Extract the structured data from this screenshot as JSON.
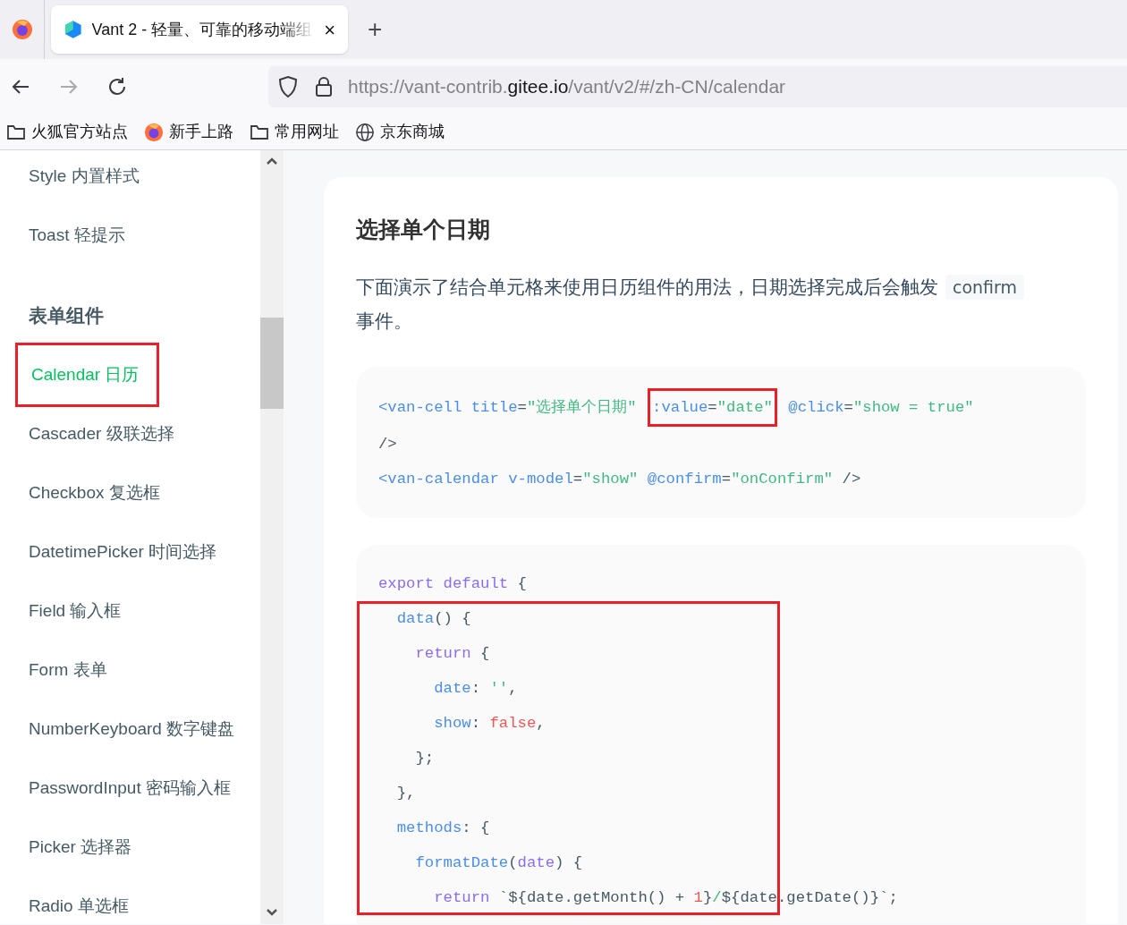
{
  "browser": {
    "tab": {
      "title": "Vant 2 - 轻量、可靠的移动端组",
      "close": "×",
      "selected": true
    },
    "new_tab": "+",
    "url": {
      "scheme_host": "https://vant-contrib.",
      "domain": "gitee.io",
      "path": "/vant/v2/#/zh-CN/calendar"
    },
    "bookmarks": [
      {
        "label": "火狐官方站点",
        "kind": "folder"
      },
      {
        "label": "新手上路",
        "kind": "firefox"
      },
      {
        "label": "常用网址",
        "kind": "folder"
      },
      {
        "label": "京东商城",
        "kind": "globe"
      }
    ]
  },
  "sidebar": {
    "items": [
      {
        "kind": "item",
        "label": "Style 内置样式",
        "selected": false,
        "highlighted": false
      },
      {
        "kind": "item",
        "label": "Toast 轻提示",
        "selected": false,
        "highlighted": false
      },
      {
        "kind": "group",
        "label": "表单组件"
      },
      {
        "kind": "item",
        "label": "Calendar 日历",
        "selected": true,
        "highlighted": true
      },
      {
        "kind": "item",
        "label": "Cascader 级联选择",
        "selected": false,
        "highlighted": false
      },
      {
        "kind": "item",
        "label": "Checkbox 复选框",
        "selected": false,
        "highlighted": false
      },
      {
        "kind": "item",
        "label": "DatetimePicker 时间选择",
        "selected": false,
        "highlighted": false
      },
      {
        "kind": "item",
        "label": "Field 输入框",
        "selected": false,
        "highlighted": false
      },
      {
        "kind": "item",
        "label": "Form 表单",
        "selected": false,
        "highlighted": false
      },
      {
        "kind": "item",
        "label": "NumberKeyboard 数字键盘",
        "selected": false,
        "highlighted": false
      },
      {
        "kind": "item",
        "label": "PasswordInput 密码输入框",
        "selected": false,
        "highlighted": false
      },
      {
        "kind": "item",
        "label": "Picker 选择器",
        "selected": false,
        "highlighted": false
      },
      {
        "kind": "item",
        "label": "Radio 单选框",
        "selected": false,
        "highlighted": false
      }
    ]
  },
  "content": {
    "heading": "选择单个日期",
    "paragraph": {
      "before": "下面演示了结合单元格来使用日历组件的用法，日期选择完成后会触发",
      "code": "confirm",
      "after": "事件。"
    },
    "code_blocks": [
      {
        "lines": [
          {
            "tokens": [
              {
                "text": "<van-cell",
                "kind": "tag"
              },
              {
                "text": " title",
                "kind": "attr"
              },
              {
                "text": "=",
                "kind": "plain"
              },
              {
                "text": "\"选择单个日期\" ",
                "kind": "string"
              },
              {
                "text": ":value",
                "kind": "attr",
                "highlighted": true
              },
              {
                "text": "=",
                "kind": "plain",
                "highlighted": true
              },
              {
                "text": "\"date\"",
                "kind": "string",
                "highlighted": true
              },
              {
                "text": " @click",
                "kind": "attr"
              },
              {
                "text": "=",
                "kind": "plain"
              },
              {
                "text": "\"show = true\"",
                "kind": "string"
              }
            ]
          },
          {
            "tokens": [
              {
                "text": "/>",
                "kind": "plain"
              }
            ]
          },
          {
            "tokens": [
              {
                "text": "<van-calendar",
                "kind": "tag"
              },
              {
                "text": " v-model",
                "kind": "attr"
              },
              {
                "text": "=",
                "kind": "plain"
              },
              {
                "text": "\"show\"",
                "kind": "string"
              },
              {
                "text": " @confirm",
                "kind": "attr"
              },
              {
                "text": "=",
                "kind": "plain"
              },
              {
                "text": "\"onConfirm\"",
                "kind": "string"
              },
              {
                "text": " />",
                "kind": "plain"
              }
            ]
          }
        ]
      },
      {
        "lines": [
          {
            "tokens": [
              {
                "text": "export default",
                "kind": "keyword"
              },
              {
                "text": " {",
                "kind": "plain"
              }
            ]
          },
          {
            "highlighted": true,
            "tokens": [
              {
                "text": "  data",
                "kind": "attr"
              },
              {
                "text": "() {",
                "kind": "plain"
              }
            ]
          },
          {
            "highlighted": true,
            "tokens": [
              {
                "text": "    return",
                "kind": "keyword"
              },
              {
                "text": " {",
                "kind": "plain"
              }
            ]
          },
          {
            "highlighted": true,
            "tokens": [
              {
                "text": "      date",
                "kind": "attr"
              },
              {
                "text": ": ",
                "kind": "plain"
              },
              {
                "text": "''",
                "kind": "string"
              },
              {
                "text": ",",
                "kind": "plain"
              }
            ]
          },
          {
            "highlighted": true,
            "tokens": [
              {
                "text": "      show",
                "kind": "attr"
              },
              {
                "text": ": ",
                "kind": "plain"
              },
              {
                "text": "false",
                "kind": "literal"
              },
              {
                "text": ",",
                "kind": "plain"
              }
            ]
          },
          {
            "highlighted": true,
            "tokens": [
              {
                "text": "    };",
                "kind": "plain"
              }
            ]
          },
          {
            "highlighted": true,
            "tokens": [
              {
                "text": "  },",
                "kind": "plain"
              }
            ]
          },
          {
            "highlighted": true,
            "tokens": [
              {
                "text": "  methods",
                "kind": "attr"
              },
              {
                "text": ": {",
                "kind": "plain"
              }
            ]
          },
          {
            "highlighted": true,
            "tokens": [
              {
                "text": "    formatDate",
                "kind": "attr"
              },
              {
                "text": "(",
                "kind": "plain"
              },
              {
                "text": "date",
                "kind": "keyword"
              },
              {
                "text": ") {",
                "kind": "plain"
              }
            ]
          },
          {
            "highlighted": true,
            "tokens": [
              {
                "text": "      return",
                "kind": "keyword"
              },
              {
                "text": " `${date.getMonth() + ",
                "kind": "plain"
              },
              {
                "text": "1",
                "kind": "literal"
              },
              {
                "text": "}",
                "kind": "plain"
              },
              {
                "text": "/",
                "kind": "string"
              },
              {
                "text": "${date.getDate()}`;",
                "kind": "plain"
              }
            ]
          }
        ]
      }
    ]
  }
}
